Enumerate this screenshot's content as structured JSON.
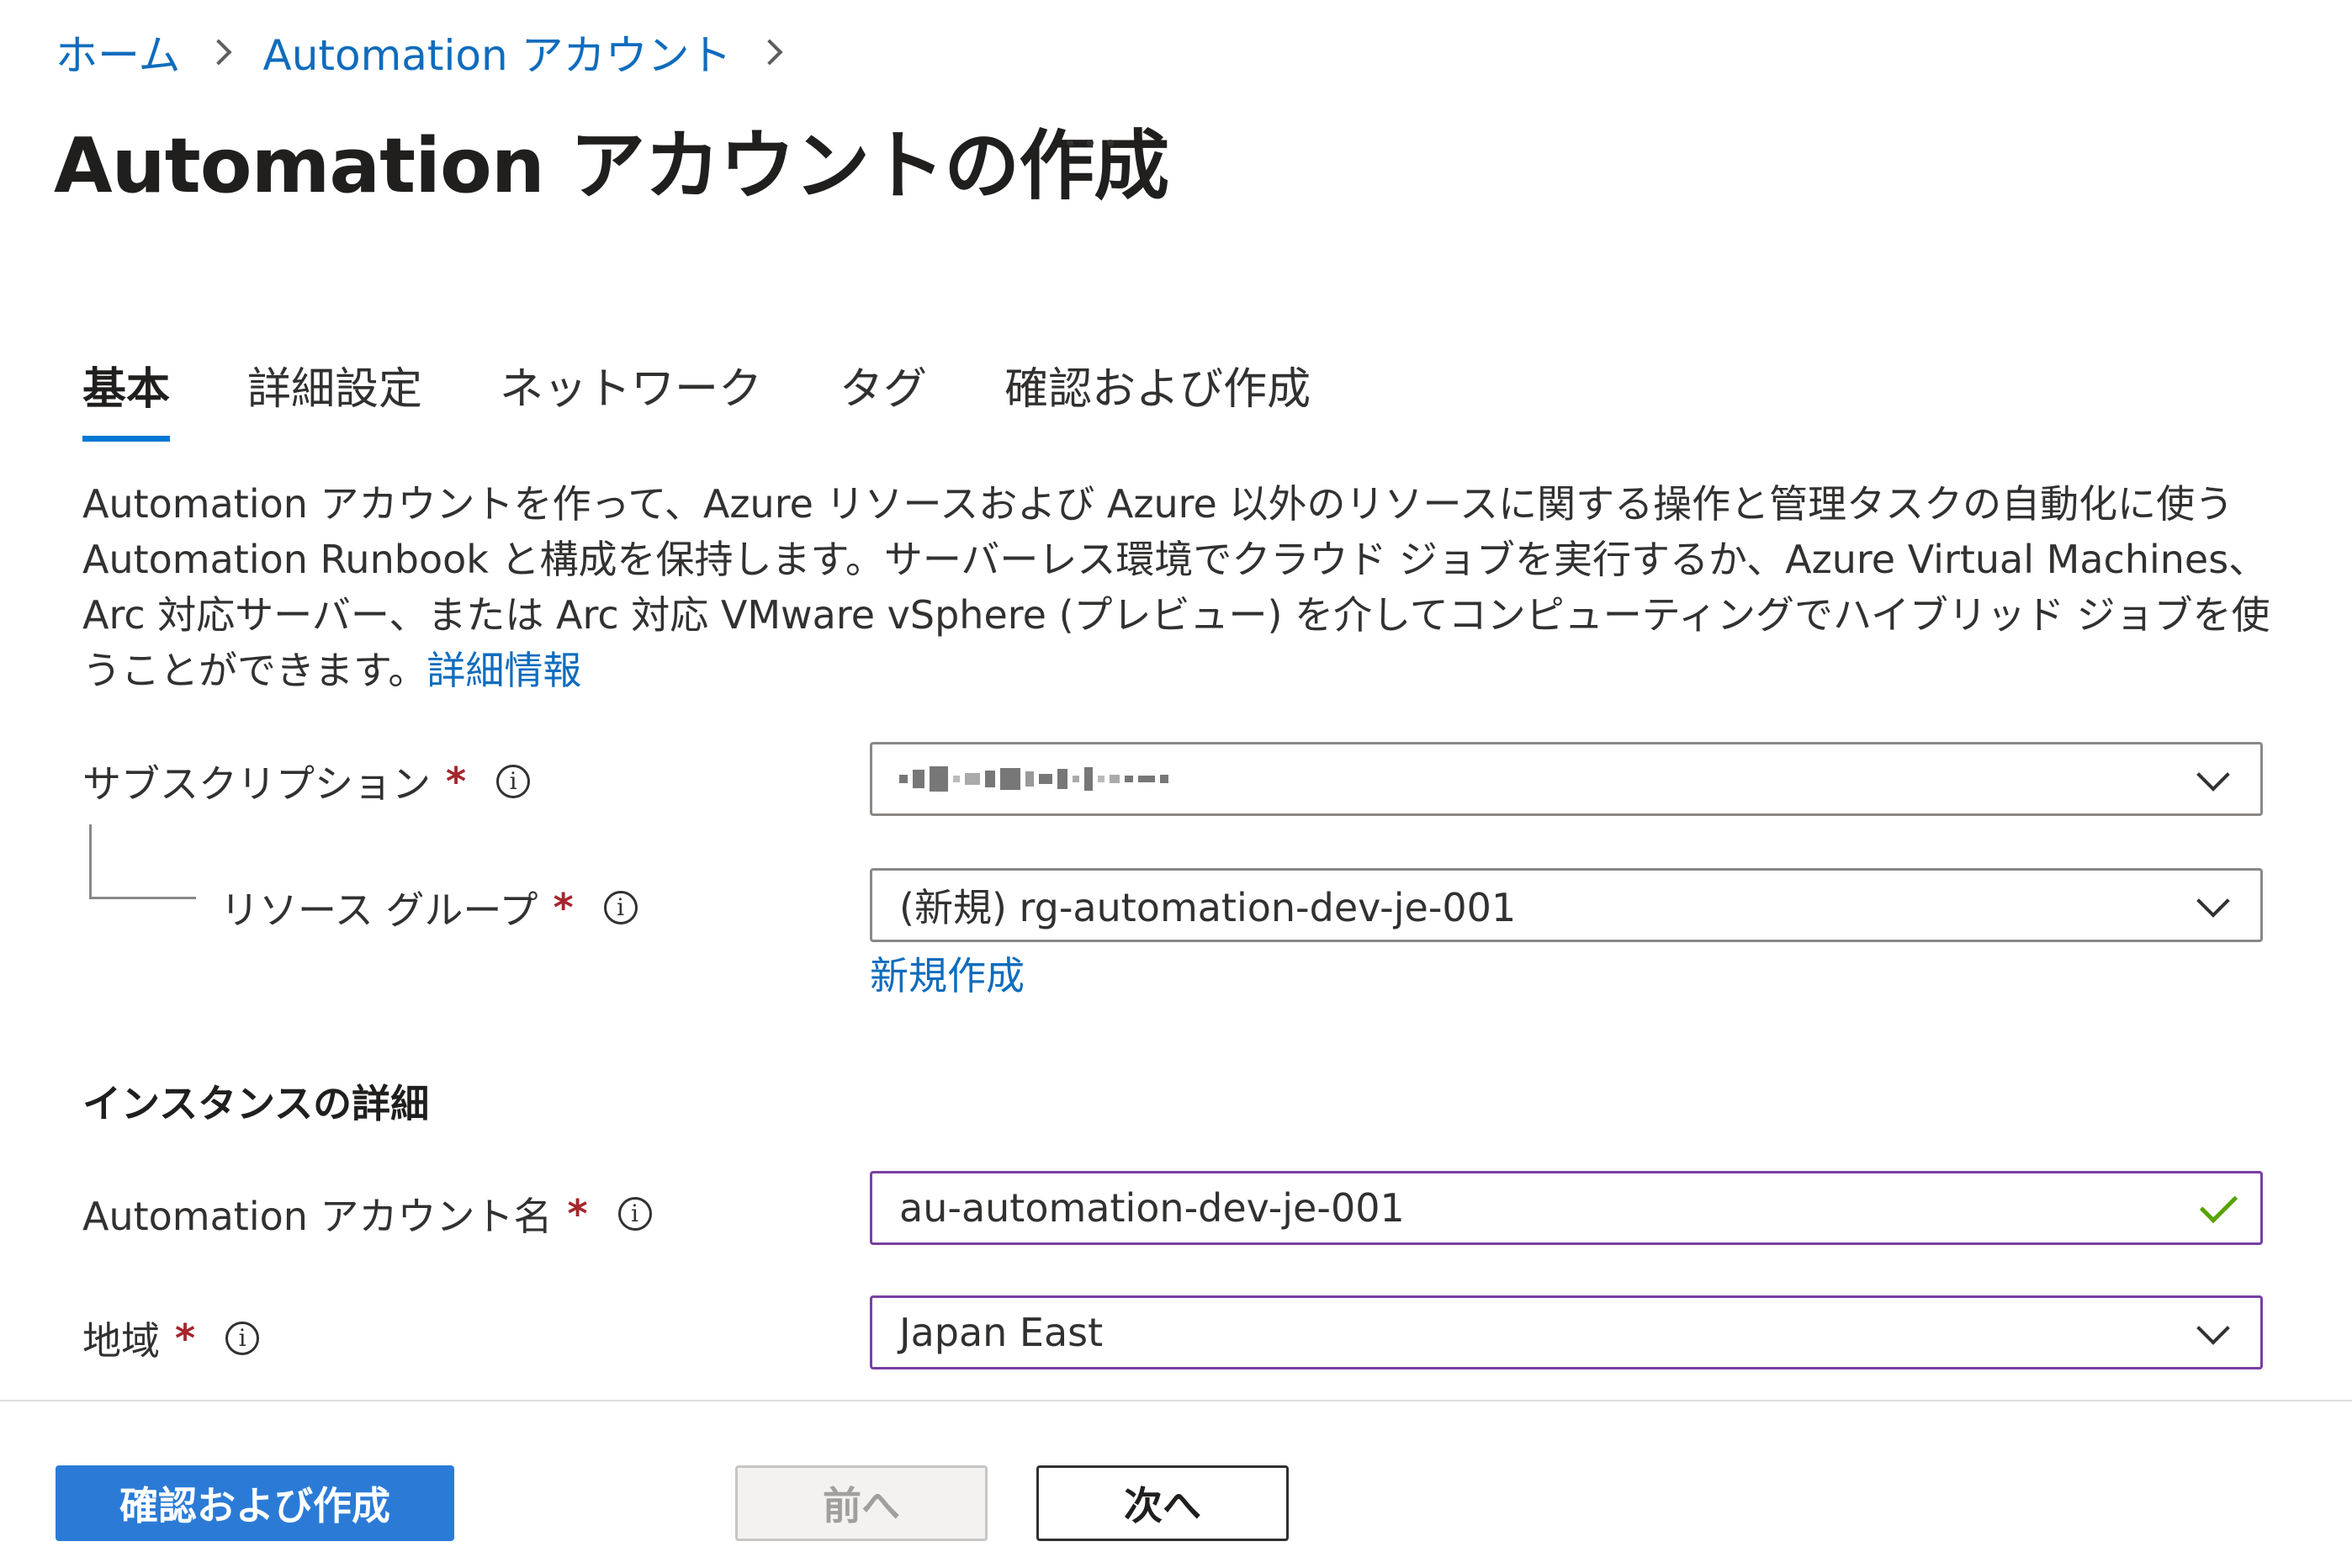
{
  "breadcrumb": {
    "items": [
      "ホーム",
      "Automation アカウント"
    ]
  },
  "page": {
    "title": "Automation アカウントの作成",
    "more_icon": "more-horizontal-icon"
  },
  "tabs": [
    {
      "label": "基本",
      "active": true
    },
    {
      "label": "詳細設定",
      "active": false
    },
    {
      "label": "ネットワーク",
      "active": false
    },
    {
      "label": "タグ",
      "active": false
    },
    {
      "label": "確認および作成",
      "active": false
    }
  ],
  "description": {
    "text": "Automation アカウントを作って、Azure リソースおよび Azure 以外のリソースに関する操作と管理タスクの自動化に使う Automation Runbook と構成を保持します。サーバーレス環境でクラウド ジョブを実行するか、Azure Virtual Machines、Arc 対応サーバー、または Arc 対応 VMware vSphere (プレビュー) を介してコンピューティングでハイブリッド ジョブを使うことができます。",
    "link": "詳細情報"
  },
  "form": {
    "required_mark": "*",
    "subscription": {
      "label": "サブスクリプション",
      "value_redacted": true
    },
    "resource_group": {
      "label": "リソース グループ",
      "value": "(新規) rg-automation-dev-je-001",
      "create_new_link": "新規作成"
    },
    "instance_section": "インスタンスの詳細",
    "account_name": {
      "label": "Automation アカウント名",
      "value": "au-automation-dev-je-001",
      "valid": true
    },
    "region": {
      "label": "地域",
      "value": "Japan East"
    }
  },
  "footer": {
    "review_create": "確認および作成",
    "previous": "前へ",
    "next": "次へ"
  },
  "colors": {
    "accent": "#0078d4",
    "link": "#0f6cbd",
    "required": "#a4262c",
    "focused_border": "#7a3fa3",
    "valid_check": "#57a300",
    "primary_button": "#2b7bd6"
  }
}
